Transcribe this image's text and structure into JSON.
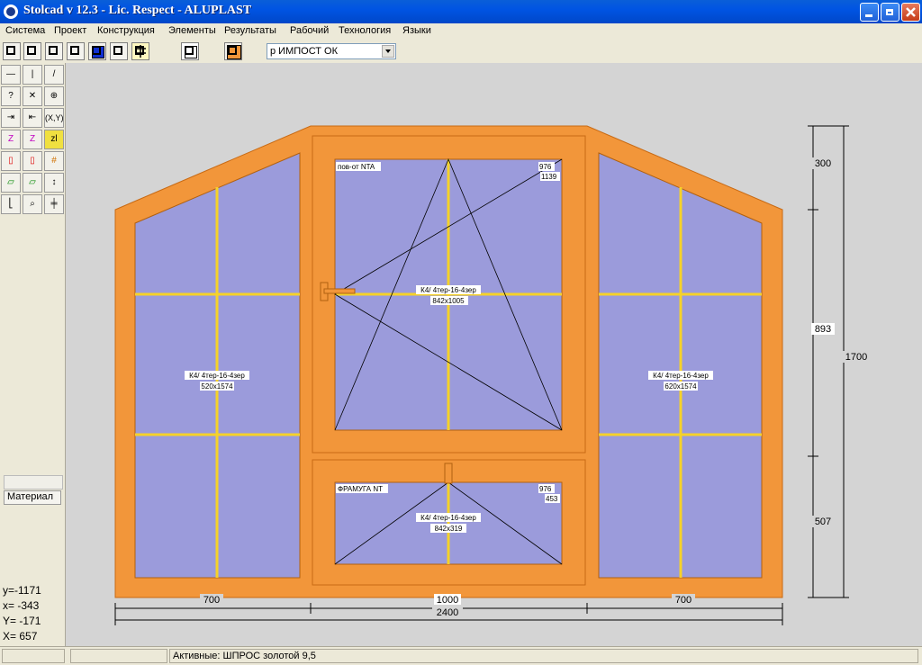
{
  "window": {
    "title": "Stolcad v 12.3 - Lic. Respect - ALUPLAST"
  },
  "menu": [
    "Система",
    "Проект",
    "Конструкция",
    "Элементы",
    "Результаты",
    "Рабочий",
    "Технология",
    "Языки"
  ],
  "toolbar": {
    "profile_select": "р ИМПОСТ ОК"
  },
  "sidebar": {
    "material_label": "Материал"
  },
  "coords": {
    "y_small": "y=-1171",
    "x_small": "x= -343",
    "Y_big": "Y= -171",
    "X_big": "X=  657"
  },
  "status": {
    "active": "Активные: ШПРОС золотой 9,5"
  },
  "colors": {
    "frame": "#f2963a",
    "glass": "#9b9bdb",
    "muntin": "#f5d22a"
  },
  "drawing": {
    "left_glass": {
      "line1": "К4/ 4тер-16-4зер",
      "line2": "520x1574"
    },
    "center_top_glass": {
      "line1": "К4/ 4тер-16-4зер",
      "line2": "842x1005"
    },
    "center_bottom_glass": {
      "line1": "К4/ 4тер-16-4зер",
      "line2": "842x319"
    },
    "right_glass": {
      "line1": "К4/ 4тер-16-4зер",
      "line2": "620x1574"
    },
    "sash_top": {
      "label": "пов-от NTA",
      "dim1": "976",
      "dim2": "1139"
    },
    "sash_bottom": {
      "label": "ФРАМУГА NT",
      "dim1": "976",
      "dim2": "453"
    },
    "dims_bottom": {
      "left": "700",
      "center": "1000",
      "right": "700",
      "total": "2400"
    },
    "dims_right": {
      "top": "300",
      "middle": "893",
      "bottom": "507",
      "total": "1700"
    }
  }
}
